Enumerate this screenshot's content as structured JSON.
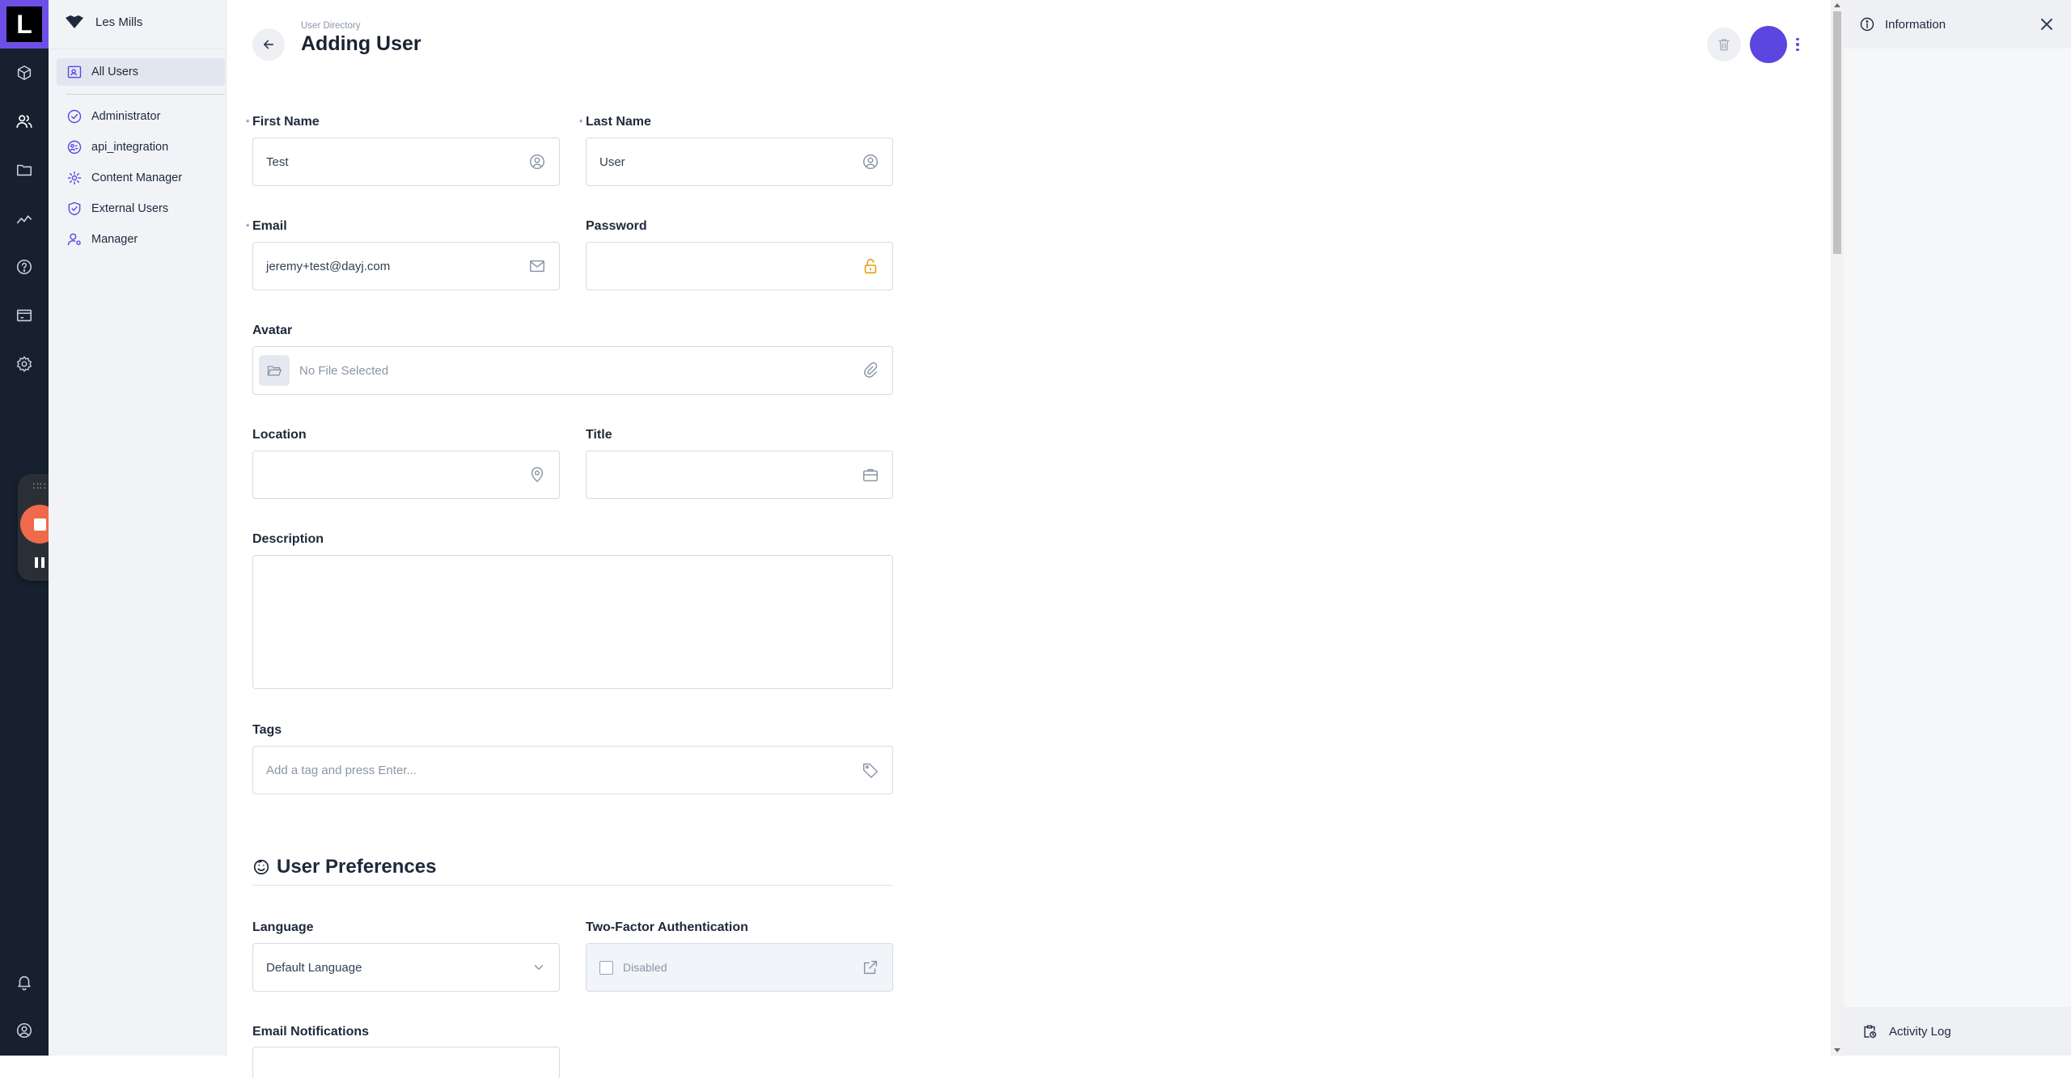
{
  "org": {
    "name": "Les Mills",
    "logo_letter": "L"
  },
  "rail": {
    "icons": [
      "cube-icon",
      "users-icon",
      "folder-icon",
      "chart-icon",
      "help-icon",
      "billing-icon",
      "settings-icon",
      "bell-icon",
      "account-icon"
    ]
  },
  "recorder": {
    "grip": "∷∷"
  },
  "sidebar": {
    "all_users": "All Users",
    "roles": [
      "Administrator",
      "api_integration",
      "Content Manager",
      "External Users",
      "Manager"
    ]
  },
  "header": {
    "breadcrumb": "User Directory",
    "title": "Adding User"
  },
  "form": {
    "first_name": {
      "label": "First Name",
      "value": "Test",
      "required": "*"
    },
    "last_name": {
      "label": "Last Name",
      "value": "User",
      "required": "*"
    },
    "email": {
      "label": "Email",
      "value": "jeremy+test@dayj.com",
      "required": "*"
    },
    "password": {
      "label": "Password",
      "value": ""
    },
    "avatar": {
      "label": "Avatar",
      "placeholder": "No File Selected"
    },
    "location": {
      "label": "Location",
      "value": ""
    },
    "title": {
      "label": "Title",
      "value": ""
    },
    "description": {
      "label": "Description",
      "value": ""
    },
    "tags": {
      "label": "Tags",
      "placeholder": "Add a tag and press Enter..."
    }
  },
  "preferences": {
    "section_title": "User Preferences",
    "language": {
      "label": "Language",
      "value": "Default Language"
    },
    "two_factor": {
      "label": "Two-Factor Authentication",
      "value": "Disabled"
    },
    "email_notifications": {
      "label": "Email Notifications"
    }
  },
  "info_panel": {
    "title": "Information",
    "activity_log": "Activity Log"
  },
  "colors": {
    "accent": "#5b47e0",
    "rail_bg": "#16202f",
    "logo_bg": "#6d4fe8",
    "record": "#ef6a4b",
    "lock": "#e8a317"
  }
}
